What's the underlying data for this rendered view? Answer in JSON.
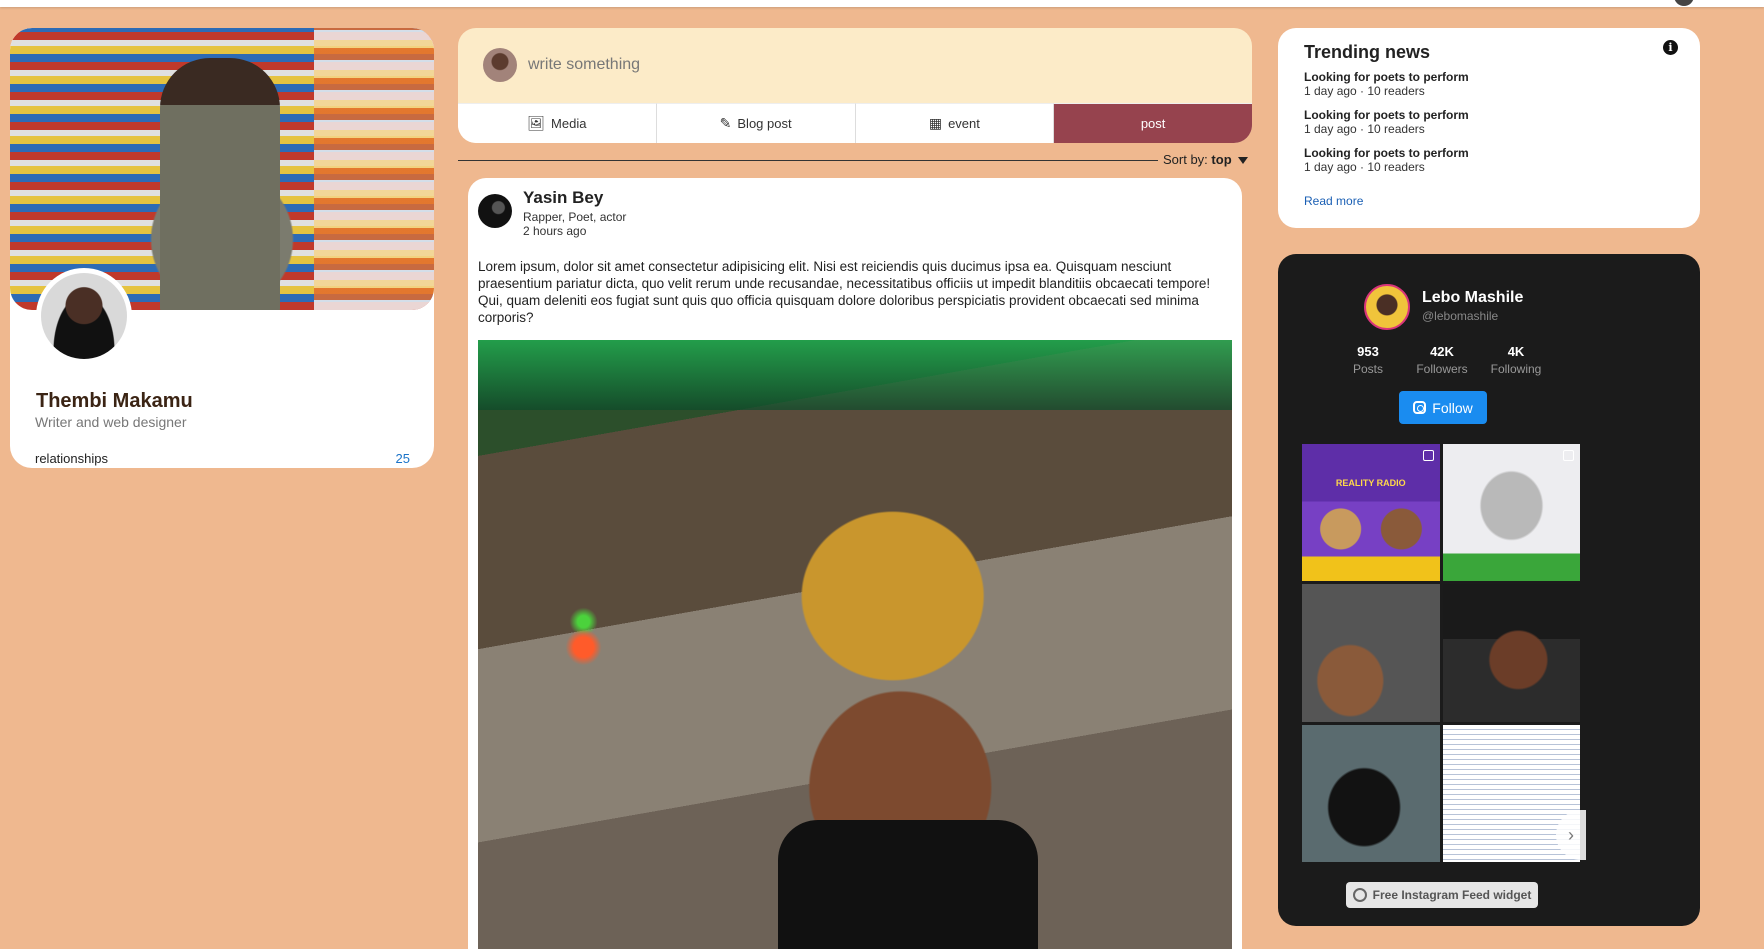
{
  "profile": {
    "name": "Thembi Makamu",
    "subtitle": "Writer and web designer",
    "relationships_label": "relationships",
    "relationships_count": "25"
  },
  "composer": {
    "placeholder": "write something",
    "tabs": [
      {
        "label": "Media",
        "icon": "image-icon"
      },
      {
        "label": "Blog post",
        "icon": "pen-icon"
      },
      {
        "label": "event",
        "icon": "calendar-icon"
      },
      {
        "label": "post",
        "icon": ""
      }
    ]
  },
  "sort": {
    "label": "Sort by:",
    "value": "top"
  },
  "post": {
    "author": "Yasin Bey",
    "role": "Rapper, Poet, actor",
    "time": "2 hours ago",
    "text": "Lorem ipsum, dolor sit amet consectetur adipisicing elit. Nisi est reiciendis quis ducimus ipsa ea. Quisquam nesciunt praesentium pariatur dicta, quo velit rerum unde recusandae, necessitatibus officiis ut impedit blanditiis obcaecati tempore! Qui, quam deleniti eos fugiat sunt quis quo officia quisquam dolore doloribus perspiciatis provident obcaecati sed minima corporis?"
  },
  "trending": {
    "title": "Trending news",
    "items": [
      {
        "title": "Looking for poets to perform",
        "meta": "1 day ago · 10 readers"
      },
      {
        "title": "Looking for poets to perform",
        "meta": "1 day ago · 10 readers"
      },
      {
        "title": "Looking for poets to perform",
        "meta": "1 day ago · 10 readers"
      }
    ],
    "read_more": "Read more"
  },
  "instagram": {
    "name": "Lebo Mashile",
    "handle": "@lebomashile",
    "stats": [
      {
        "value": "953",
        "label": "Posts"
      },
      {
        "value": "42K",
        "label": "Followers"
      },
      {
        "value": "4K",
        "label": "Following"
      }
    ],
    "follow_label": "Follow",
    "tile1_text": "REALITY RADIO",
    "badge": "Free Instagram Feed widget"
  }
}
